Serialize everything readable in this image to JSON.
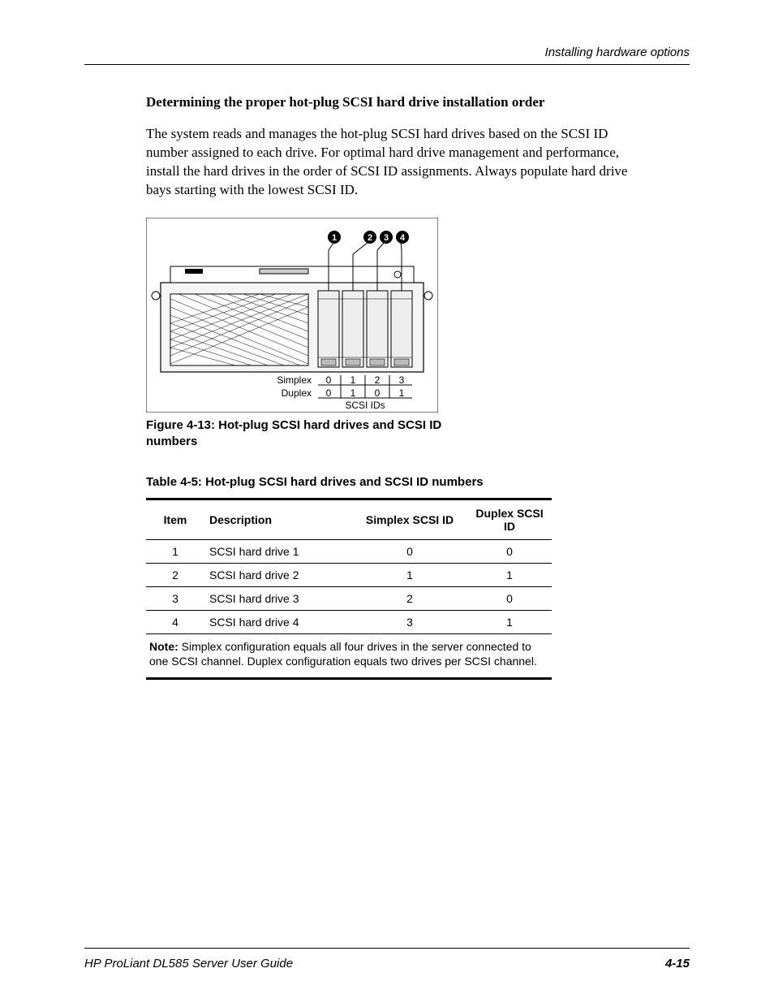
{
  "header": {
    "section": "Installing hardware options"
  },
  "section_title": "Determining the proper hot-plug SCSI hard drive installation order",
  "paragraph": "The system reads and manages the hot-plug SCSI hard drives based on the SCSI ID number assigned to each drive. For optimal hard drive management and performance, install the hard drives in the order of SCSI ID assignments. Always populate hard drive bays starting with the lowest SCSI ID.",
  "figure": {
    "caption": "Figure 4-13:  Hot-plug SCSI hard drives and SCSI ID numbers",
    "callouts": [
      "1",
      "2",
      "3",
      "4"
    ],
    "labels": {
      "simplex": "Simplex",
      "duplex": "Duplex",
      "scsi_ids": "SCSI IDs"
    },
    "simplex_ids": [
      "0",
      "1",
      "2",
      "3"
    ],
    "duplex_ids": [
      "0",
      "1",
      "0",
      "1"
    ]
  },
  "table": {
    "caption": "Table 4-5:  Hot-plug SCSI hard drives and SCSI ID numbers",
    "headers": {
      "item": "Item",
      "description": "Description",
      "simplex": "Simplex SCSI ID",
      "duplex": "Duplex SCSI ID"
    },
    "rows": [
      {
        "item": "1",
        "description": "SCSI hard drive 1",
        "simplex": "0",
        "duplex": "0"
      },
      {
        "item": "2",
        "description": "SCSI hard drive 2",
        "simplex": "1",
        "duplex": "1"
      },
      {
        "item": "3",
        "description": "SCSI hard drive 3",
        "simplex": "2",
        "duplex": "0"
      },
      {
        "item": "4",
        "description": "SCSI hard drive 4",
        "simplex": "3",
        "duplex": "1"
      }
    ],
    "note_label": "Note:",
    "note_text": "  Simplex configuration equals all four drives in the server connected to one SCSI channel. Duplex configuration equals two drives per SCSI channel."
  },
  "footer": {
    "left": "HP ProLiant DL585 Server User Guide",
    "right": "4-15"
  }
}
